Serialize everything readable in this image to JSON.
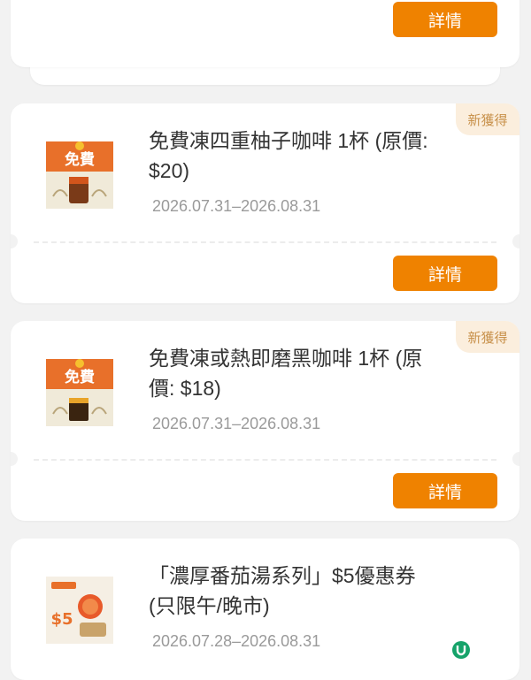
{
  "coupons": [
    {
      "button": "詳情"
    },
    {
      "badge": "新獲得",
      "title": "免費凍四重柚子咖啡 1杯 (原價: $20)",
      "dates": "2026.07.31–2026.08.31",
      "button": "詳情",
      "thumb_label": "免費"
    },
    {
      "badge": "新獲得",
      "title": "免費凍或熱即磨黑咖啡 1杯 (原價: $18)",
      "dates": "2026.07.31–2026.08.31",
      "button": "詳情",
      "thumb_label": "免費"
    },
    {
      "title": "「濃厚番茄湯系列」$5優惠券 (只限午/晚市)",
      "dates": "2026.07.28–2026.08.31",
      "thumb_label": "$5"
    }
  ],
  "colors": {
    "accent": "#ef8200",
    "badge_bg": "#fbeedd",
    "badge_text": "#c8914b"
  }
}
